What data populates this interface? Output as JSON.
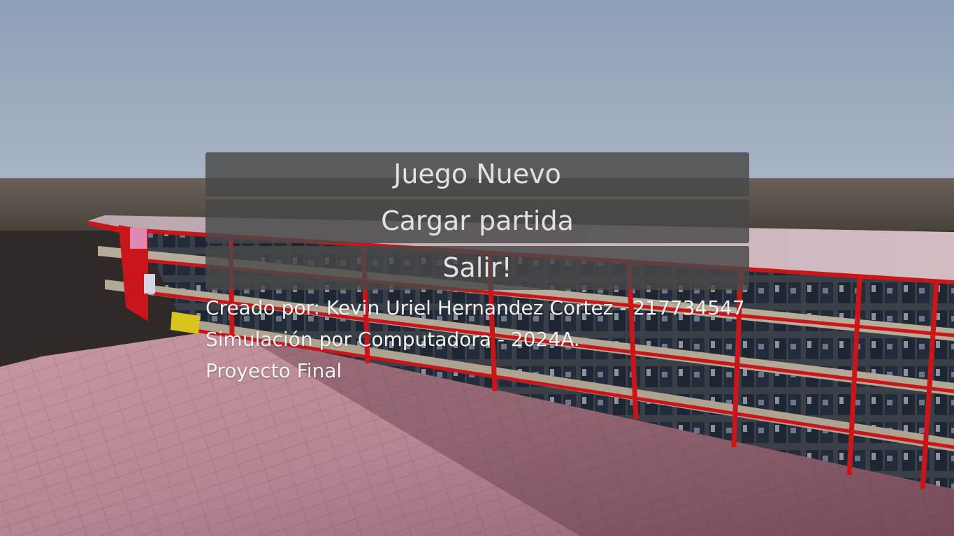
{
  "menu": {
    "new_game_label": "Juego Nuevo",
    "load_game_label": "Cargar partida",
    "exit_label": "Salir!"
  },
  "credits": {
    "author_line": "Creado por: Kevin Uriel Hernandez Cortez - 217734547",
    "course_line": "Simulación por Computadora - 2024A.",
    "project_line": "Proyecto Final"
  },
  "colors": {
    "button_bg": "#484848",
    "button_text": "#e2e2e2",
    "credit_text": "#f4f4f4",
    "building_frame": "#c8161b",
    "ground": "#b87f8c",
    "sky_top": "#8e9fb8"
  }
}
